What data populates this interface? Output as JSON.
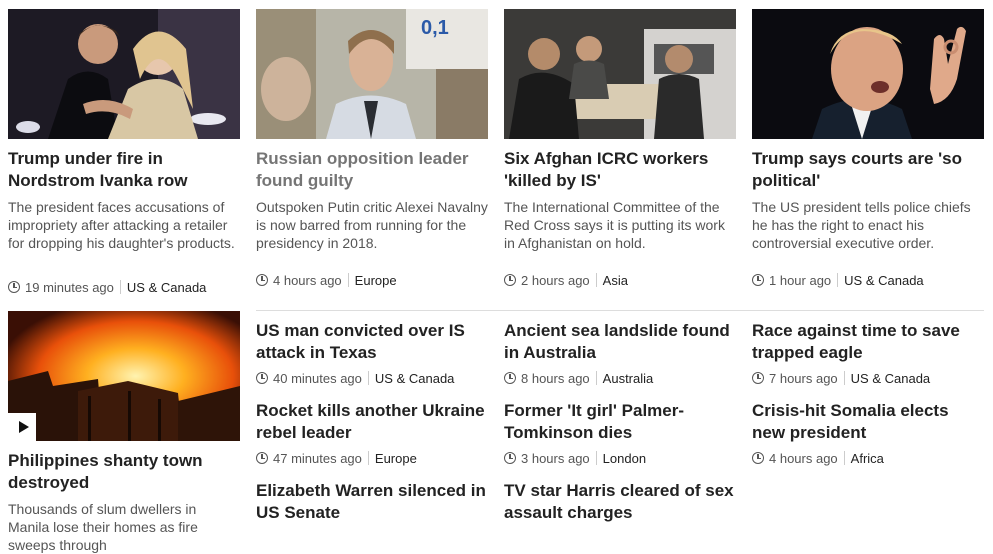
{
  "stories": [
    {
      "title": "Trump under fire in Nordstrom Ivanka row",
      "summary": "The president faces accusations of impropriety after attacking a retailer for dropping his daughter's products.",
      "time": "19 minutes ago",
      "section": "US & Canada"
    },
    {
      "title": "Russian opposition leader found guilty",
      "summary": "Outspoken Putin critic Alexei Navalny is now barred from running for the presidency in 2018.",
      "time": "4 hours ago",
      "section": "Europe"
    },
    {
      "title": "Six Afghan ICRC workers 'killed by IS'",
      "summary": "The International Committee of the Red Cross says it is putting its work in Afghanistan on hold.",
      "time": "2 hours ago",
      "section": "Asia"
    },
    {
      "title": "Trump says courts are 'so political'",
      "summary": "The US president tells police chiefs he has the right to enact his controversial executive order.",
      "time": "1 hour ago",
      "section": "US & Canada"
    },
    {
      "title": "Philippines shanty town destroyed",
      "summary": "Thousands of slum dwellers in Manila lose their homes as fire sweeps through"
    },
    {
      "title": "US man convicted over IS attack in Texas",
      "time": "40 minutes ago",
      "section": "US & Canada"
    },
    {
      "title": "Rocket kills another Ukraine rebel leader",
      "time": "47 minutes ago",
      "section": "Europe"
    },
    {
      "title": "Elizabeth Warren silenced in US Senate"
    },
    {
      "title": "Ancient sea landslide found in Australia",
      "time": "8 hours ago",
      "section": "Australia"
    },
    {
      "title": "Former 'It girl' Palmer-Tomkinson dies",
      "time": "3 hours ago",
      "section": "London"
    },
    {
      "title": "TV star Harris cleared of sex assault charges"
    },
    {
      "title": "Race against time to save trapped eagle",
      "time": "7 hours ago",
      "section": "US & Canada"
    },
    {
      "title": "Crisis-hit Somalia elects new president",
      "time": "4 hours ago",
      "section": "Africa"
    }
  ],
  "media": {
    "play_icon": "play-icon",
    "clock_icon": "clock-icon"
  }
}
